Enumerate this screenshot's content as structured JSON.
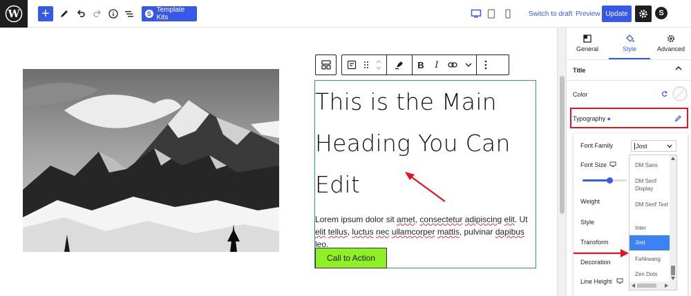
{
  "topbar": {
    "template_kits_label": "Template Kits",
    "switch_to_draft": "Switch to draft",
    "preview": "Preview",
    "update": "Update"
  },
  "canvas": {
    "heading": "This is the Main Heading You Can Edit",
    "paragraph_parts": [
      "Lorem ipsum dolor sit ",
      "amet",
      ", ",
      "consectetur",
      " ",
      "adipiscing",
      " ",
      "elit",
      ". Ut ",
      "elit",
      " ",
      "tellus",
      ", ",
      "luctus",
      " ",
      "nec",
      " ",
      "ullamcorper",
      " ",
      "mattis",
      ", pulvinar ",
      "dapibus",
      " ",
      "leo",
      "."
    ],
    "cta_label": "Call to Action",
    "block_toolbar": {
      "bold": "B",
      "italic": "I"
    }
  },
  "sidebar": {
    "tabs": [
      {
        "label": "General",
        "icon": "layout-icon"
      },
      {
        "label": "Style",
        "icon": "paint-bucket-icon",
        "active": true
      },
      {
        "label": "Advanced",
        "icon": "gear-icon"
      }
    ],
    "section_title": "Title",
    "color_label": "Color",
    "typography_label": "Typography",
    "font_family_label": "Font Family",
    "font_family_value": "Jost",
    "font_size_label": "Font Size",
    "weight_label": "Weight",
    "style_label": "Style",
    "transform_label": "Transform",
    "decoration_label": "Decoration",
    "line_height_label": "Line Height",
    "font_options": [
      "DM Sans",
      "DM Serif Display",
      "DM Serif Text",
      "Inter",
      "Jost",
      "Fahkwang",
      "Zen Dots"
    ],
    "selected_font": "Jost",
    "font_size_slider_value": 0.62
  },
  "colors": {
    "accent": "#3858e9",
    "cta_background": "#8ef025",
    "annotation_red": "#e81123",
    "dropdown_highlight": "#3b82f6"
  }
}
